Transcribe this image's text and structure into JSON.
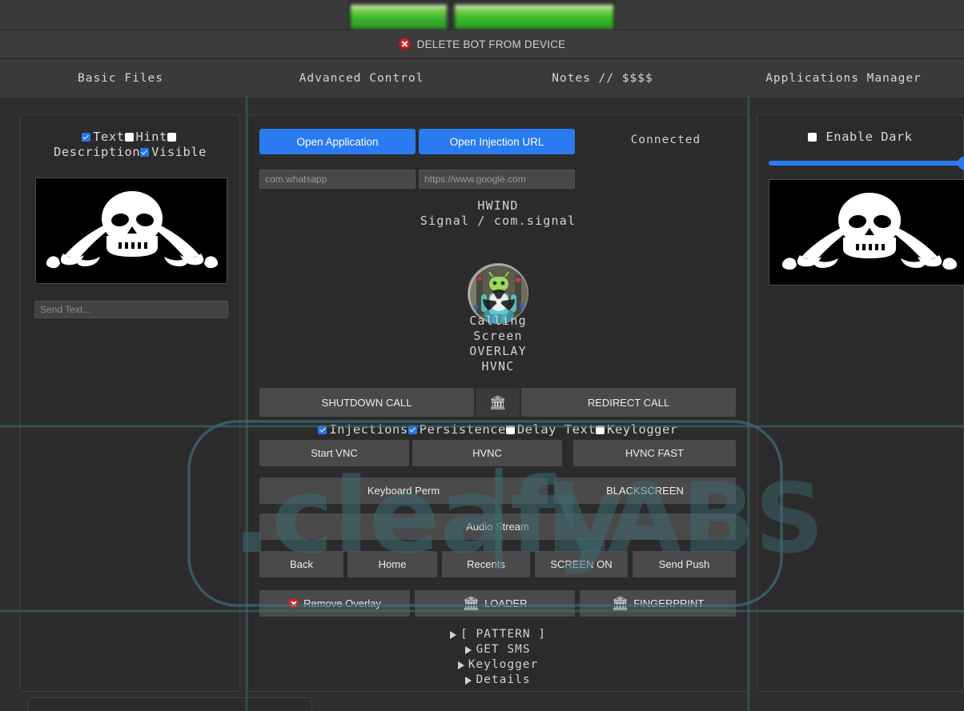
{
  "colors": {
    "page_bg": "#2e2e2e",
    "panel_bg": "#2b2b2b",
    "accent_blue": "#2a7bf0",
    "danger_red": "#d32020",
    "text": "#d4d4d4",
    "button_grey": "#4a4a4a",
    "watermark": "#3e6c74",
    "redacted_green": "#35b22a"
  },
  "topbar": {
    "redacted_block_1": "",
    "redacted_block_2": "",
    "note": "redacted green bars"
  },
  "delete_row": {
    "icon": "red-x-circle-icon",
    "label": "DELETE BOT FROM DEVICE"
  },
  "tabs": [
    {
      "label": "Basic Files"
    },
    {
      "label": "Advanced Control"
    },
    {
      "label": "Notes // $$$$"
    },
    {
      "label": "Applications Manager"
    }
  ],
  "left_panel": {
    "checkboxes": [
      {
        "label": "Text",
        "checked": true
      },
      {
        "label": "Hint",
        "checked": false
      },
      {
        "label": "Description",
        "checked": false
      },
      {
        "label": "Visible",
        "checked": true
      }
    ],
    "image": "jolly-roger-pirate-flag",
    "send_text_placeholder": "Send Text..."
  },
  "center_panel": {
    "open_application_label": "Open Application",
    "open_injection_url_label": "Open Injection URL",
    "connection_status": "Connected",
    "package_placeholder": "com.whatsapp",
    "url_placeholder": "https://www.google.com",
    "device_name": "HWIND",
    "app_line": "Signal / com.signal",
    "avatar": "android-biohazard-avatar",
    "status_stack": [
      "Calling",
      "Screen",
      "OVERLAY",
      "HVNC"
    ],
    "call_row": {
      "shutdown_label": "SHUTDOWN CALL",
      "bank_icon": "🏛",
      "redirect_label": "REDIRECT CALL"
    },
    "feature_checkboxes": [
      {
        "label": "Injections",
        "checked": true
      },
      {
        "label": "Persistence",
        "checked": true
      },
      {
        "label": "Delay Text",
        "checked": false
      },
      {
        "label": "Keylogger",
        "checked": false
      }
    ],
    "vnc_row": [
      "Start VNC",
      "HVNC",
      "HVNC FAST"
    ],
    "perm_row": [
      "Keyboard Perm",
      "BLACKSCREEN"
    ],
    "audio_label": "Audio Stream",
    "nav_row": [
      "Back",
      "Home",
      "Recents",
      "SCREEN ON",
      "Send Push"
    ],
    "overlay_row": [
      {
        "label": "Remove Overlay",
        "icon": "red-x-circle-icon"
      },
      {
        "label": "LOADER",
        "icon": "🏛"
      },
      {
        "label": "FINGERPRINT",
        "icon": "🏛"
      }
    ],
    "tree": [
      {
        "label": "[ PATTERN ]"
      },
      {
        "label": "GET SMS"
      },
      {
        "label": "Keylogger"
      },
      {
        "label": "Details"
      }
    ]
  },
  "right_panel": {
    "enable_dark_label": "Enable Dark",
    "enable_dark_checked": false,
    "slider_value": 100,
    "image": "jolly-roger-pirate-flag"
  },
  "watermark": {
    "text_left": ".cleafy",
    "text_right": "LABS"
  }
}
